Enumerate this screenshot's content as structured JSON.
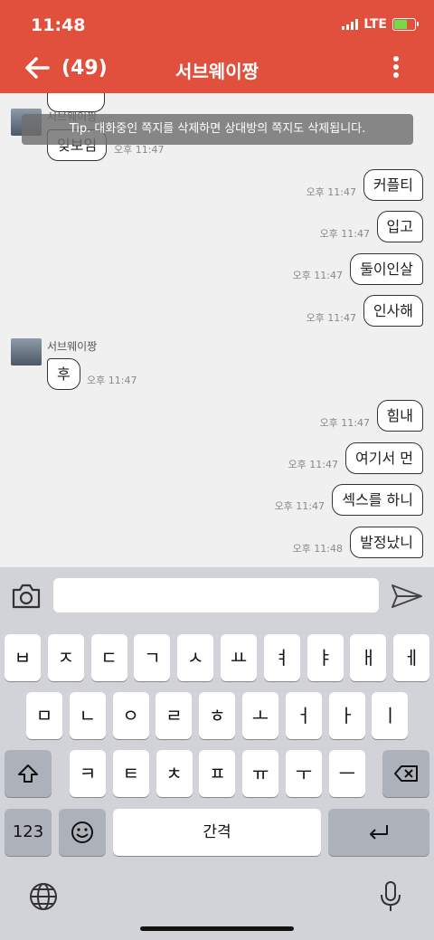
{
  "status": {
    "time": "11:48",
    "network": "LTE",
    "battery_level": 0.6,
    "battery_color": "#7bd648"
  },
  "header": {
    "unread_count": "(49)",
    "title": "서브웨이짱",
    "background": "#e0503c"
  },
  "tip": "Tip. 대화중인 쪽지를 삭제하면 상대방의 쪽지도 삭제됩니다.",
  "messages": {
    "partial_sender": "서브웨이짱",
    "partial_text": "잊보임",
    "partial_time": "오후 11:47",
    "m1": {
      "text": "커플티",
      "time": "오후 11:47"
    },
    "m2": {
      "text": "입고",
      "time": "오후 11:47"
    },
    "m3": {
      "text": "둘이인살",
      "time": "오후 11:47"
    },
    "m4": {
      "text": "인사해",
      "time": "오후 11:47"
    },
    "sender2": "서브웨이짱",
    "m5": {
      "text": "후",
      "time": "오후 11:47"
    },
    "m6": {
      "text": "힘내",
      "time": "오후 11:47"
    },
    "m7": {
      "text": "여기서 먼",
      "time": "오후 11:47"
    },
    "m8": {
      "text": "섹스를 하니",
      "time": "오후 11:47"
    },
    "m9": {
      "text": "발정났니",
      "time": "오후 11:48"
    }
  },
  "input": {
    "value": "",
    "placeholder": ""
  },
  "keyboard": {
    "row1": [
      "ㅂ",
      "ㅈ",
      "ㄷ",
      "ㄱ",
      "ㅅ",
      "ㅛ",
      "ㅕ",
      "ㅑ",
      "ㅐ",
      "ㅔ"
    ],
    "row2": [
      "ㅁ",
      "ㄴ",
      "ㅇ",
      "ㄹ",
      "ㅎ",
      "ㅗ",
      "ㅓ",
      "ㅏ",
      "ㅣ"
    ],
    "row3": [
      "ㅋ",
      "ㅌ",
      "ㅊ",
      "ㅍ",
      "ㅠ",
      "ㅜ",
      "ㅡ"
    ],
    "numbers_label": "123",
    "space_label": "간격"
  },
  "icons": [
    "back-arrow-icon",
    "more-icon",
    "camera-icon",
    "send-icon",
    "shift-icon",
    "delete-icon",
    "emoji-icon",
    "return-icon",
    "globe-icon",
    "microphone-icon"
  ]
}
